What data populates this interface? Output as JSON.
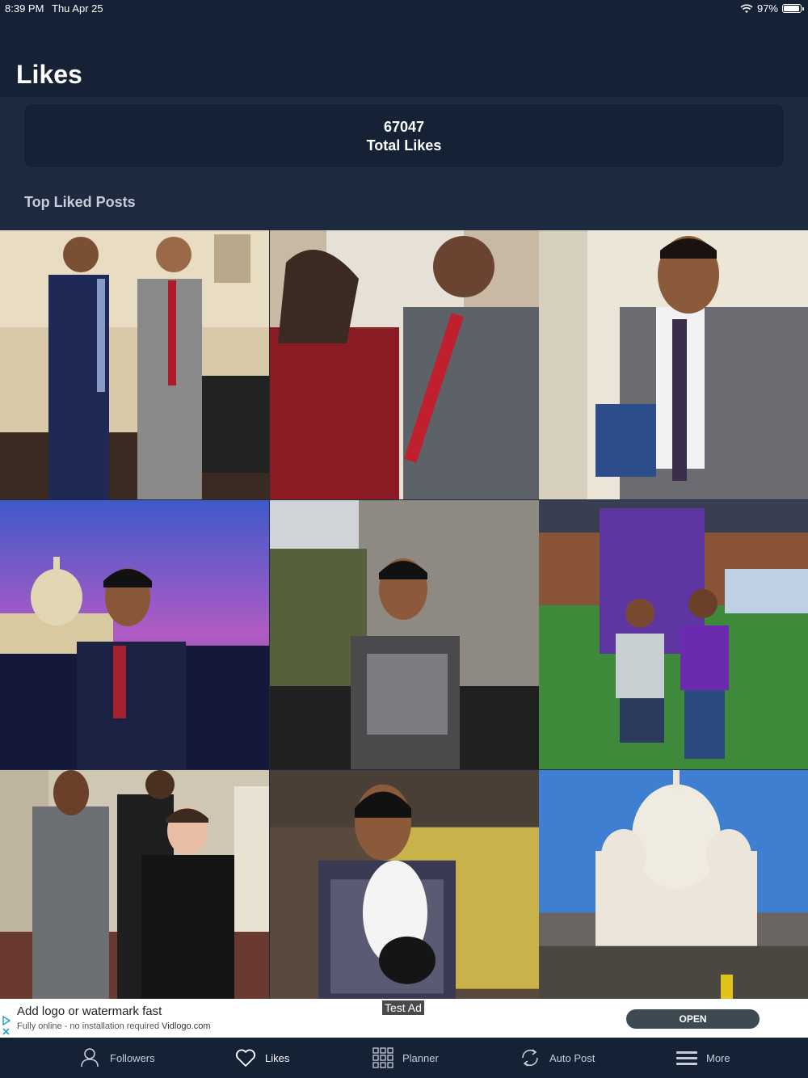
{
  "status_bar": {
    "time": "8:39 PM",
    "date": "Thu Apr 25",
    "battery": "97%"
  },
  "header": {
    "title": "Likes"
  },
  "totals": {
    "value": "67047",
    "label": "Total Likes"
  },
  "section": {
    "title": "Top Liked Posts"
  },
  "posts": [
    {
      "id": "post-1"
    },
    {
      "id": "post-2"
    },
    {
      "id": "post-3"
    },
    {
      "id": "post-4"
    },
    {
      "id": "post-5"
    },
    {
      "id": "post-6"
    },
    {
      "id": "post-7"
    },
    {
      "id": "post-8"
    },
    {
      "id": "post-9"
    }
  ],
  "ad": {
    "title": "Add logo or watermark fast",
    "subtitle": "Fully online - no installation required",
    "brand": "Vidlogo.com",
    "badge": "Test Ad",
    "button": "OPEN"
  },
  "tabs": [
    {
      "label": "Followers",
      "icon": "person-icon"
    },
    {
      "label": "Likes",
      "icon": "heart-icon"
    },
    {
      "label": "Planner",
      "icon": "grid-icon"
    },
    {
      "label": "Auto Post",
      "icon": "repeat-icon"
    },
    {
      "label": "More",
      "icon": "menu-icon"
    }
  ],
  "colors": {
    "background": "#1d2a3f",
    "header": "#152236",
    "tab_inactive": "#c7ceda"
  }
}
